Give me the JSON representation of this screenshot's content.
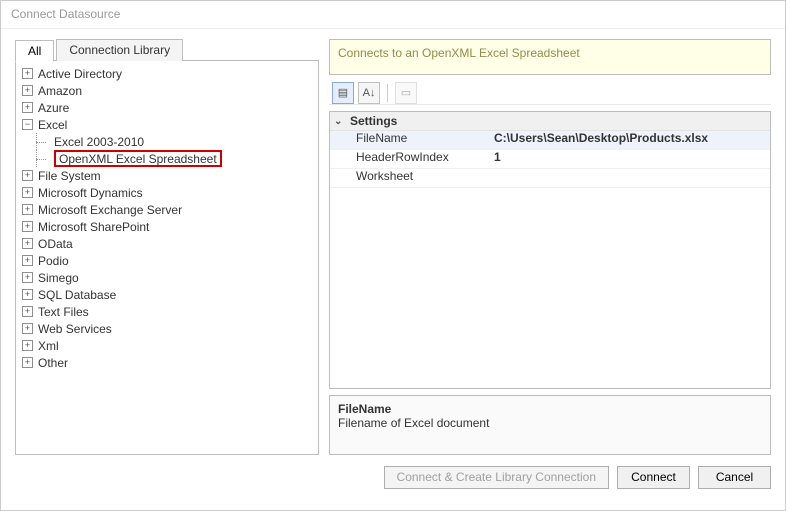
{
  "window": {
    "title": "Connect Datasource"
  },
  "tabs": {
    "all": "All",
    "library": "Connection Library"
  },
  "tree": {
    "nodes": [
      {
        "label": "Active Directory",
        "icon": "plus"
      },
      {
        "label": "Amazon",
        "icon": "plus"
      },
      {
        "label": "Azure",
        "icon": "plus"
      },
      {
        "label": "Excel",
        "icon": "minus",
        "children": [
          {
            "label": "Excel 2003-2010"
          },
          {
            "label": "OpenXML Excel Spreadsheet",
            "selected": true
          }
        ]
      },
      {
        "label": "File System",
        "icon": "plus"
      },
      {
        "label": "Microsoft Dynamics",
        "icon": "plus"
      },
      {
        "label": "Microsoft Exchange Server",
        "icon": "plus"
      },
      {
        "label": "Microsoft SharePoint",
        "icon": "plus"
      },
      {
        "label": "OData",
        "icon": "plus"
      },
      {
        "label": "Podio",
        "icon": "plus"
      },
      {
        "label": "Simego",
        "icon": "plus"
      },
      {
        "label": "SQL Database",
        "icon": "plus"
      },
      {
        "label": "Text Files",
        "icon": "plus"
      },
      {
        "label": "Web Services",
        "icon": "plus"
      },
      {
        "label": "Xml",
        "icon": "plus"
      },
      {
        "label": "Other",
        "icon": "plus"
      }
    ]
  },
  "description": "Connects to an OpenXML Excel Spreadsheet",
  "toolbar": {
    "categorized_icon": "▤",
    "az_icon": "A↓",
    "pages_icon": "▭"
  },
  "settings": {
    "section": "Settings",
    "rows": [
      {
        "name": "FileName",
        "value": "C:\\Users\\Sean\\Desktop\\Products.xlsx",
        "selected": true
      },
      {
        "name": "HeaderRowIndex",
        "value": "1"
      },
      {
        "name": "Worksheet",
        "value": ""
      }
    ]
  },
  "help": {
    "title": "FileName",
    "text": "Filename of Excel document"
  },
  "buttons": {
    "create_lib": "Connect & Create Library Connection",
    "connect": "Connect",
    "cancel": "Cancel"
  }
}
